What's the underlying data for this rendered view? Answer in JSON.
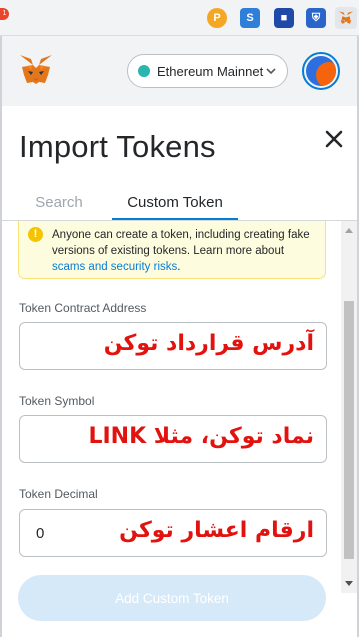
{
  "browser_toolbar": {
    "notification_count": "1",
    "extensions": [
      {
        "icon": "pocket-extension-icon",
        "glyph": "P"
      },
      {
        "icon": "s-extension-icon",
        "glyph": "S"
      },
      {
        "icon": "bookmark-extension-icon",
        "glyph": "■"
      },
      {
        "icon": "bitwarden-extension-icon",
        "glyph": "⛨"
      },
      {
        "icon": "metamask-extension-icon",
        "glyph": "🦊"
      }
    ]
  },
  "header": {
    "network": "Ethereum Mainnet",
    "network_color": "#29b6af"
  },
  "page": {
    "title": "Import Tokens",
    "tabs": [
      {
        "label": "Search",
        "active": false
      },
      {
        "label": "Custom Token",
        "active": true
      }
    ]
  },
  "warning": {
    "text": "Anyone can create a token, including creating fake versions of existing tokens. Learn more about ",
    "link": "scams and security risks",
    "suffix": "."
  },
  "fields": {
    "contract_address": {
      "label": "Token Contract Address",
      "value": "",
      "annotation": "آدرس قرارداد توکن"
    },
    "symbol": {
      "label": "Token Symbol",
      "value": "",
      "annotation": "نماد توکن، مثلا LINK"
    },
    "decimal": {
      "label": "Token Decimal",
      "value": "0",
      "annotation": "ارقام اعشار توکن"
    }
  },
  "footer": {
    "add_button": "Add Custom Token"
  },
  "colors": {
    "accent": "#037dd6",
    "annotation": "#e2130f",
    "warning_bg": "#fefcde"
  }
}
